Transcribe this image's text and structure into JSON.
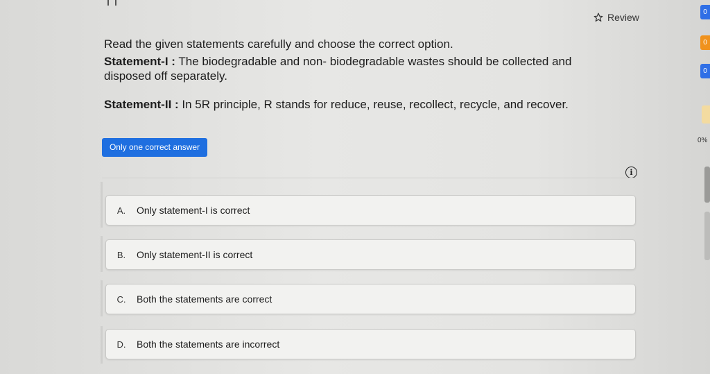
{
  "header": {
    "review_label": "Review"
  },
  "question": {
    "intro": "Read the given statements carefully and choose the correct option.",
    "statement1_label": "Statement-I :",
    "statement1_text": " The biodegradable and non- biodegradable wastes should be collected and disposed off separately.",
    "statement2_label": "Statement-II :",
    "statement2_text": " In 5R principle, R stands for reduce, reuse, recollect, recycle, and recover.",
    "answer_type": "Only one correct answer"
  },
  "options": [
    {
      "letter": "A.",
      "text": "Only statement-I is correct"
    },
    {
      "letter": "B.",
      "text": "Only statement-II is correct"
    },
    {
      "letter": "C.",
      "text": "Both the statements are correct"
    },
    {
      "letter": "D.",
      "text": "Both the statements are incorrect"
    }
  ],
  "side_panel": {
    "counts": [
      "0",
      "0",
      "0"
    ],
    "percent": "0%",
    "colors": {
      "blue": "#2f6fe6",
      "orange": "#f0921d"
    }
  },
  "icons": {
    "review": "star-icon",
    "info": "info-icon"
  }
}
